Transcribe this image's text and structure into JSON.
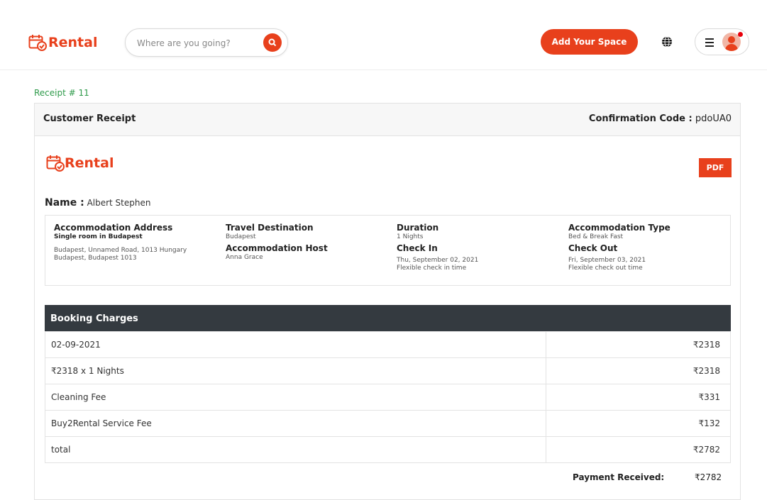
{
  "header": {
    "logo_text": "Rental",
    "search": {
      "placeholder": "Where are you going?"
    },
    "add_space_label": "Add Your Space"
  },
  "receipt": {
    "number_label": "Receipt # 11",
    "title": "Customer Receipt",
    "confirmation_label": "Confirmation Code :",
    "confirmation_code": "pdoUA0",
    "logo_text": "Rental",
    "pdf_label": "PDF",
    "name_label": "Name :",
    "name": "Albert Stephen",
    "details": {
      "accommodation_address": {
        "label": "Accommodation Address",
        "title": "Single room in Budapest",
        "line1": "Budapest, Unnamed Road, 1013 Hungary",
        "line2": "Budapest, Budapest 1013"
      },
      "travel_destination": {
        "label": "Travel Destination",
        "value": "Budapest"
      },
      "accommodation_host": {
        "label": "Accommodation Host",
        "value": "Anna Grace"
      },
      "duration": {
        "label": "Duration",
        "value": "1 Nights"
      },
      "check_in": {
        "label": "Check In",
        "date": "Thu, September 02, 2021",
        "note": "Flexible check in time"
      },
      "accommodation_type": {
        "label": "Accommodation Type",
        "value": "Bed & Break Fast"
      },
      "check_out": {
        "label": "Check Out",
        "date": "Fri, September 03, 2021",
        "note": "Flexible check out time"
      }
    },
    "charges": {
      "title": "Booking Charges",
      "rows": [
        {
          "label": "02-09-2021",
          "amount": "₹2318"
        },
        {
          "label": "₹2318 x 1 Nights",
          "amount": "₹2318"
        },
        {
          "label": "Cleaning Fee",
          "amount": "₹331"
        },
        {
          "label": "Buy2Rental Service Fee",
          "amount": "₹132"
        },
        {
          "label": "total",
          "amount": "₹2782"
        }
      ]
    },
    "payment_label": "Payment Received:",
    "payment_amount": "₹2782"
  },
  "colors": {
    "accent": "#e8401c",
    "receipt_number": "#2e9a4a",
    "table_header": "#343a40"
  },
  "icons": [
    "calendar-check-icon",
    "search-icon",
    "globe-icon",
    "hamburger-icon",
    "avatar",
    "notification-dot"
  ]
}
